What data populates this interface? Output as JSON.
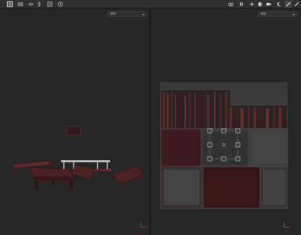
{
  "toolbar": {
    "left_icons": [
      "grid-view-icon",
      "columns-icon",
      "move-horizontal-icon",
      "move-vertical-icon",
      "frame-icon",
      "history-icon"
    ],
    "right_icons": [
      "camera-icon",
      "pause-icon",
      "light-icon",
      "material-ball-icon",
      "video-icon",
      "moon-icon",
      "brush-icon",
      "brush-icon"
    ]
  },
  "viewport_3d": {
    "view_mode": "材质"
  },
  "viewport_2d": {
    "view_mode": "材质"
  },
  "colors": {
    "background": "#252525",
    "toolbar": "#303030",
    "wood_dark": "#3a1d1d",
    "wood_red": "#5a2424",
    "selection": "#d0d0d0",
    "axis_x": "#d03030",
    "axis_y": "#3070d0"
  }
}
